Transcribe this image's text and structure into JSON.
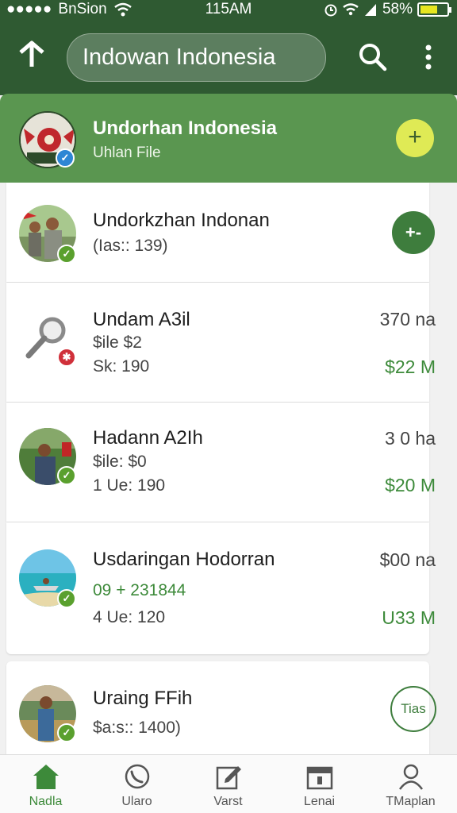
{
  "status_bar": {
    "signal_dots": "●●●●●",
    "carrier": "BnSion",
    "time": "115AM",
    "battery_text": "58%",
    "battery_level": 0.58
  },
  "app_bar": {
    "search_text": "Indowan Indonesia"
  },
  "featured": {
    "title": "Undorhan Indonesia",
    "subtitle": "Uhlan File",
    "add_label": "+"
  },
  "cards": [
    {
      "title": "Undorkzhan Indonan",
      "line1": "(Ias:: 139)",
      "action_label": "+-"
    },
    {
      "title": "Undam A3il",
      "line1": "$ile $2",
      "line2": "Sk: 190",
      "right_top": "370 na",
      "right_bottom": "$22 M"
    },
    {
      "title": "Hadann A2Ih",
      "line1": "$ile: $0",
      "line2": "1 Ue: 190",
      "right_top": "3 0 ha",
      "right_bottom": "$20 M"
    },
    {
      "title": "Usdaringan Hodorran",
      "line1": "09 + 231844",
      "line2": "4 Ue: 120",
      "right_top": "$00 na",
      "right_bottom": "U33 M"
    },
    {
      "title": "Uraing FFih",
      "line1": "$a:s:: 1400)",
      "action_label": "Tias"
    }
  ],
  "bottom_nav": [
    {
      "label": "Nadla",
      "icon": "home-icon",
      "active": true
    },
    {
      "label": "Ularo",
      "icon": "phone-icon",
      "active": false
    },
    {
      "label": "Varst",
      "icon": "edit-icon",
      "active": false
    },
    {
      "label": "Lenai",
      "icon": "calendar-icon",
      "active": false
    },
    {
      "label": "TMaplan",
      "icon": "person-icon",
      "active": false
    }
  ],
  "colors": {
    "primary_dark": "#2f5a32",
    "primary": "#5a9650",
    "accent_green": "#3d8a3a",
    "accent_yellow": "#dfea55"
  }
}
